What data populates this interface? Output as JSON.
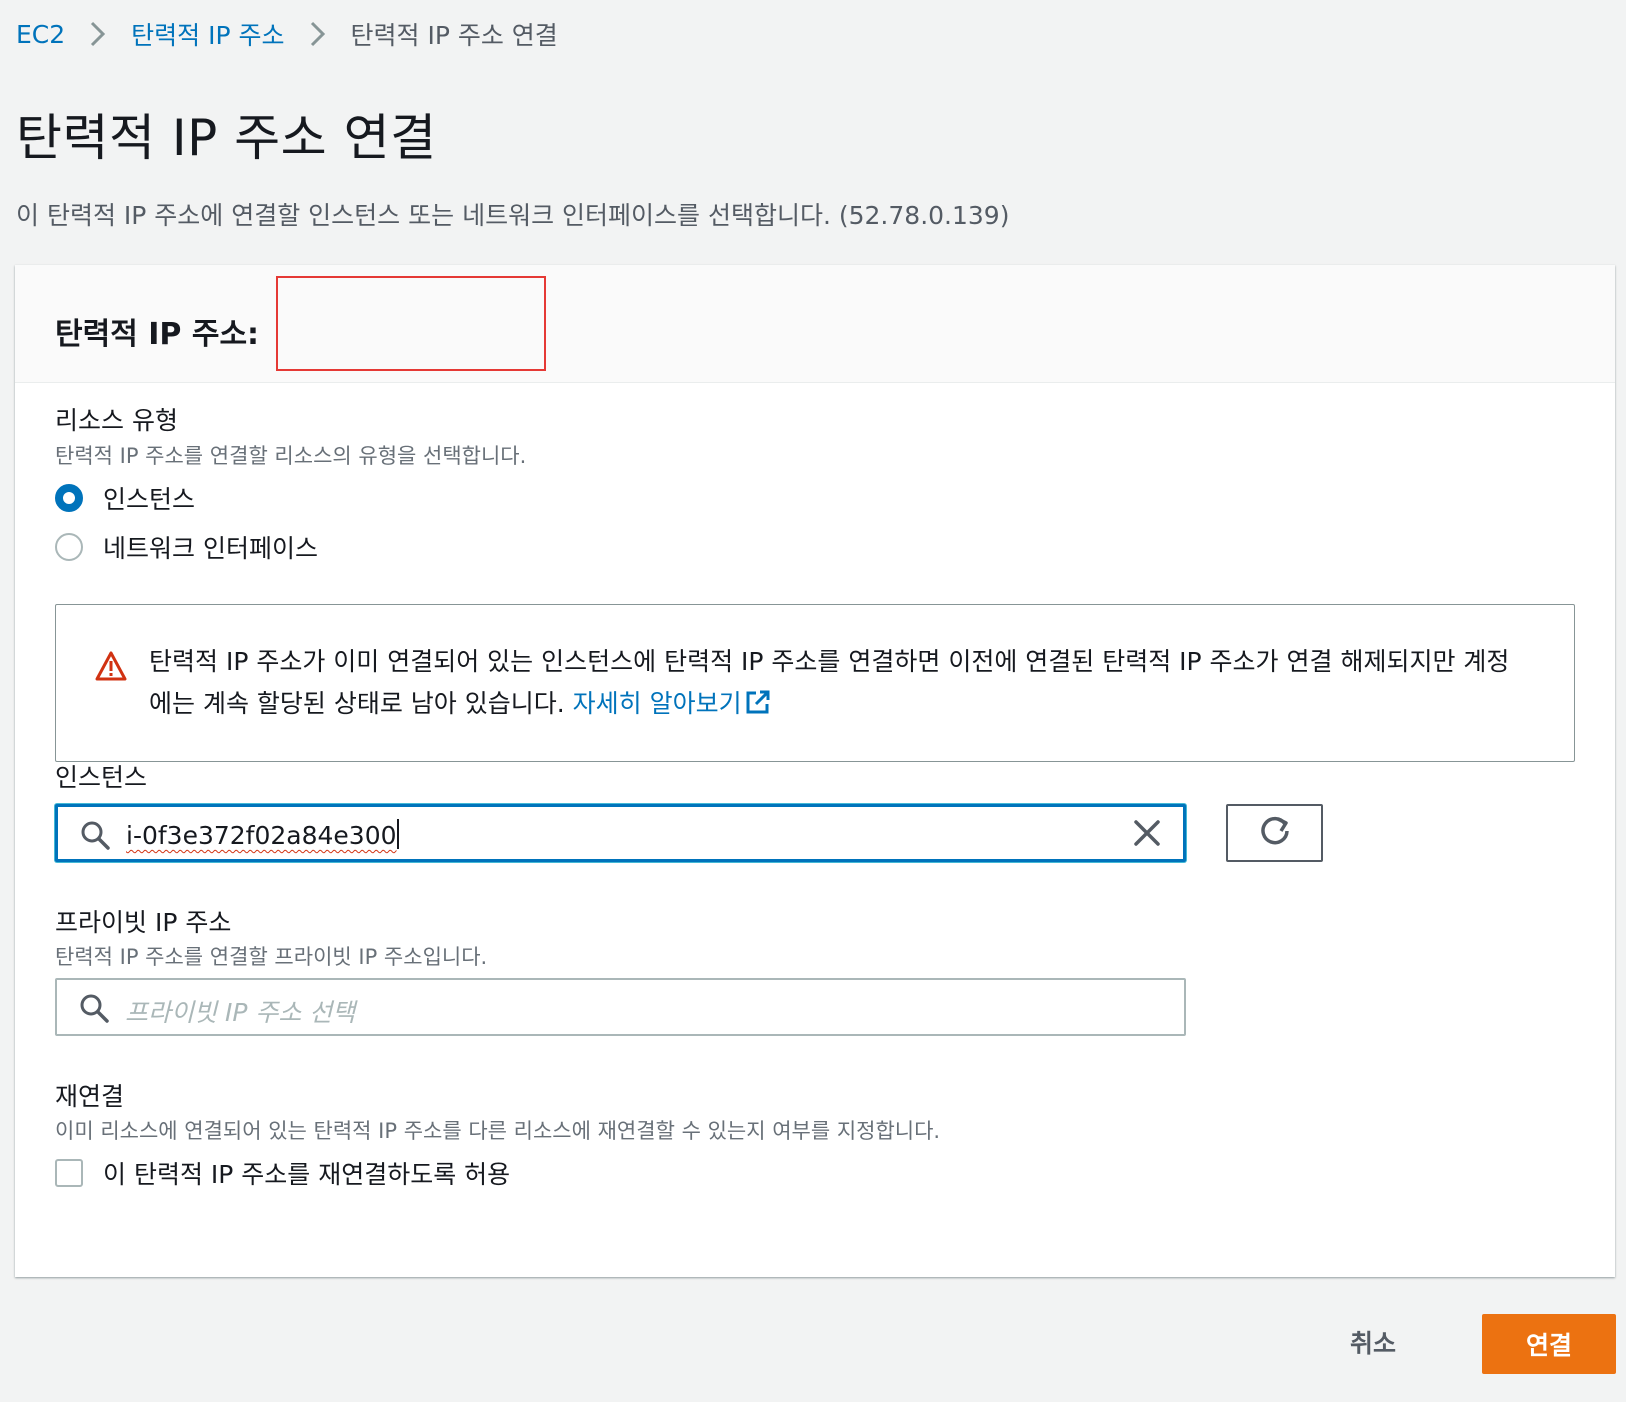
{
  "breadcrumb": {
    "items": [
      "EC2",
      "탄력적 IP 주소"
    ],
    "current": "탄력적 IP 주소 연결"
  },
  "page": {
    "title": "탄력적 IP 주소 연결",
    "description": "이 탄력적 IP 주소에 연결할 인스턴스 또는 네트워크 인터페이스를 선택합니다. (52.78.0.139)"
  },
  "panel": {
    "title": "탄력적 IP 주소:",
    "resource_type": {
      "label": "리소스 유형",
      "description": "탄력적 IP 주소를 연결할 리소스의 유형을 선택합니다.",
      "options": [
        {
          "label": "인스턴스",
          "checked": true
        },
        {
          "label": "네트워크 인터페이스",
          "checked": false
        }
      ]
    },
    "alert": {
      "text": "탄력적 IP 주소가 이미 연결되어 있는 인스턴스에 탄력적 IP 주소를 연결하면 이전에 연결된 탄력적 IP 주소가 연결 해제되지만 계정에는 계속 할당된 상태로 남아 있습니다. ",
      "link": "자세히 알아보기"
    },
    "instance": {
      "label": "인스턴스",
      "value": "i-0f3e372f02a84e300"
    },
    "private_ip": {
      "label": "프라이빗 IP 주소",
      "description": "탄력적 IP 주소를 연결할 프라이빗 IP 주소입니다.",
      "placeholder": "프라이빗 IP 주소 선택"
    },
    "reassociate": {
      "label": "재연결",
      "description": "이미 리소스에 연결되어 있는 탄력적 IP 주소를 다른 리소스에 재연결할 수 있는지 여부를 지정합니다.",
      "checkbox_label": "이 탄력적 IP 주소를 재연결하도록 허용",
      "checked": false
    }
  },
  "actions": {
    "cancel": "취소",
    "submit": "연결"
  },
  "colors": {
    "link": "#0073bb",
    "primary": "#ec7211",
    "warning": "#d13212",
    "redaction": "#e53935"
  }
}
